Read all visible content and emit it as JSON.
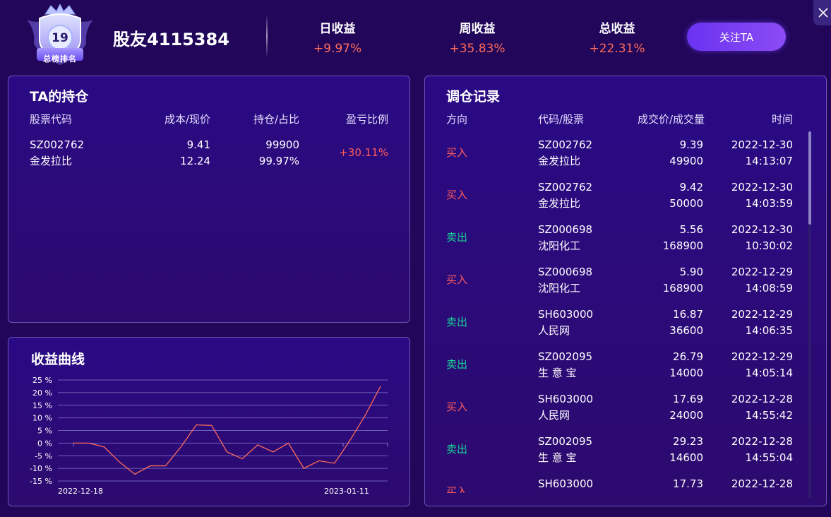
{
  "header": {
    "badge": {
      "rank": "19",
      "label": "总榜排名"
    },
    "username": "股友4115384",
    "stats": [
      {
        "label": "日收益",
        "value": "+9.97%"
      },
      {
        "label": "周收益",
        "value": "+35.83%"
      },
      {
        "label": "总收益",
        "value": "+22.31%"
      }
    ],
    "follow_label": "关注TA"
  },
  "holdings": {
    "title": "TA的持仓",
    "columns": [
      "股票代码",
      "成本/现价",
      "持仓/占比",
      "盈亏比例"
    ],
    "rows": [
      {
        "code": "SZ002762",
        "name": "金发拉比",
        "cost": "9.41",
        "price": "12.24",
        "qty": "99900",
        "ratio": "99.97%",
        "pnl": "+30.11%"
      }
    ]
  },
  "chart": {
    "title": "收益曲线"
  },
  "chart_data": {
    "type": "line",
    "x_labels": [
      "2022-12-18",
      "2023-01-11"
    ],
    "y_ticks": [
      "25 %",
      "20 %",
      "15 %",
      "10 %",
      "5 %",
      "0 %",
      "-5 %",
      "-10 %",
      "-15 %"
    ],
    "ylim": [
      -15,
      25
    ],
    "grid": true,
    "line_color": "#ff6b5a",
    "values": [
      0,
      0,
      -1.5,
      -7.5,
      -12.3,
      -9,
      -9,
      -1.5,
      7.2,
      7,
      -3.5,
      -6.2,
      -0.7,
      -3.5,
      0,
      -10,
      -7,
      -8,
      1,
      11,
      22.5
    ]
  },
  "trades": {
    "title": "调仓记录",
    "columns": [
      "方向",
      "代码/股票",
      "成交价/成交量",
      "时间"
    ],
    "rows": [
      {
        "dir": "买入",
        "type": "buy",
        "code": "SZ002762",
        "name": "金发拉比",
        "price": "9.39",
        "vol": "49900",
        "date": "2022-12-30",
        "time": "14:13:07"
      },
      {
        "dir": "买入",
        "type": "buy",
        "code": "SZ002762",
        "name": "金发拉比",
        "price": "9.42",
        "vol": "50000",
        "date": "2022-12-30",
        "time": "14:03:59"
      },
      {
        "dir": "卖出",
        "type": "sell",
        "code": "SZ000698",
        "name": "沈阳化工",
        "price": "5.56",
        "vol": "168900",
        "date": "2022-12-30",
        "time": "10:30:02"
      },
      {
        "dir": "买入",
        "type": "buy",
        "code": "SZ000698",
        "name": "沈阳化工",
        "price": "5.90",
        "vol": "168900",
        "date": "2022-12-29",
        "time": "14:08:59"
      },
      {
        "dir": "卖出",
        "type": "sell",
        "code": "SH603000",
        "name": "人民网",
        "price": "16.87",
        "vol": "36600",
        "date": "2022-12-29",
        "time": "14:06:35"
      },
      {
        "dir": "卖出",
        "type": "sell",
        "code": "SZ002095",
        "name": "生 意 宝",
        "price": "26.79",
        "vol": "14000",
        "date": "2022-12-29",
        "time": "14:05:14"
      },
      {
        "dir": "买入",
        "type": "buy",
        "code": "SH603000",
        "name": "人民网",
        "price": "17.69",
        "vol": "24000",
        "date": "2022-12-28",
        "time": "14:55:42"
      },
      {
        "dir": "卖出",
        "type": "sell",
        "code": "SZ002095",
        "name": "生 意 宝",
        "price": "29.23",
        "vol": "14600",
        "date": "2022-12-28",
        "time": "14:55:04"
      },
      {
        "dir": "买入",
        "type": "buy",
        "code": "SH603000",
        "name": "",
        "price": "17.73",
        "vol": "",
        "date": "2022-12-28",
        "time": ""
      }
    ]
  },
  "colors": {
    "buy": "#ff5b5b",
    "sell": "#19d496",
    "accent": "#7a3ff2"
  }
}
